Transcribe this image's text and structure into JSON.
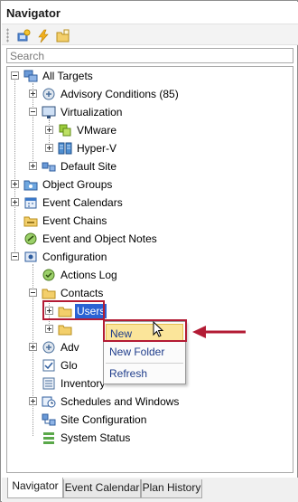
{
  "panel": {
    "title": "Navigator"
  },
  "search": {
    "placeholder": "Search",
    "value": ""
  },
  "toolbar": {
    "buttons": [
      {
        "icon": "add-target-icon"
      },
      {
        "icon": "lightning-icon"
      },
      {
        "icon": "folder-edit-icon"
      }
    ]
  },
  "tree": {
    "all_targets": "All Targets",
    "advisory_conditions": "Advisory Conditions (85)",
    "virtualization": "Virtualization",
    "vmware": "VMware",
    "hyperv": "Hyper-V",
    "default_site": "Default Site",
    "object_groups": "Object Groups",
    "event_calendars": "Event Calendars",
    "event_chains": "Event Chains",
    "event_notes": "Event and Object Notes",
    "configuration": "Configuration",
    "actions_log": "Actions Log",
    "contacts": "Contacts",
    "users": "Users",
    "advisory_partial": "Adv",
    "global_partial": "Glo",
    "inventory_partial": "Inventory",
    "schedules": "Schedules and Windows",
    "site_configuration": "Site Configuration",
    "system_status": "System Status"
  },
  "context_menu": {
    "items": [
      "New",
      "New Folder",
      "Refresh"
    ]
  },
  "tabs": [
    "Navigator",
    "Event Calendar",
    "Plan History"
  ],
  "colors": {
    "highlight": "#b31b34",
    "selection": "#2a63d4",
    "menu_hover": "#fbe59a"
  }
}
